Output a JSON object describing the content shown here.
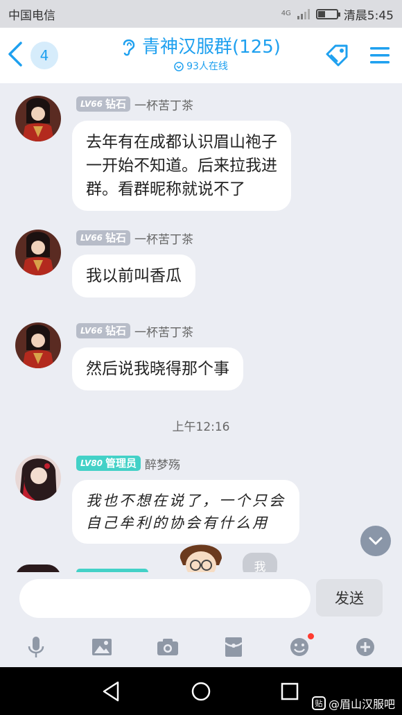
{
  "status_bar": {
    "carrier": "中国电信",
    "network": "4G",
    "time": "清晨5:45",
    "battery_level": 0.35
  },
  "header": {
    "back_count": "4",
    "title": "青神汉服群(125)",
    "online": "93人在线"
  },
  "messages": [
    {
      "level": "LV66",
      "title": "钻石",
      "tag_color": "#b7bcc8",
      "nick": "一杯苦丁茶",
      "text": "去年有在成都认识眉山袍子\n一开始不知道。后来拉我进\n群。看群昵称就说不了"
    },
    {
      "level": "LV66",
      "title": "钻石",
      "tag_color": "#b7bcc8",
      "nick": "一杯苦丁茶",
      "text": "我以前叫香瓜"
    },
    {
      "level": "LV66",
      "title": "钻石",
      "tag_color": "#b7bcc8",
      "nick": "一杯苦丁茶",
      "text": "然后说我晓得那个事"
    },
    {
      "level": "LV80",
      "title": "管理员",
      "tag_color": "#43d1c7",
      "nick": "醉梦殇",
      "text": "我也不想在说了，一个只会\n自己牟利的协会有什么用"
    }
  ],
  "timestamp": "上午12:16",
  "partial_bubble": "我",
  "input": {
    "placeholder": "",
    "send_label": "发送"
  },
  "toolbar_icons": [
    "microphone-icon",
    "image-icon",
    "camera-icon",
    "red-packet-icon",
    "emoji-icon",
    "plus-icon"
  ],
  "watermark": {
    "logo": "贴",
    "text": "@眉山汉服吧"
  }
}
